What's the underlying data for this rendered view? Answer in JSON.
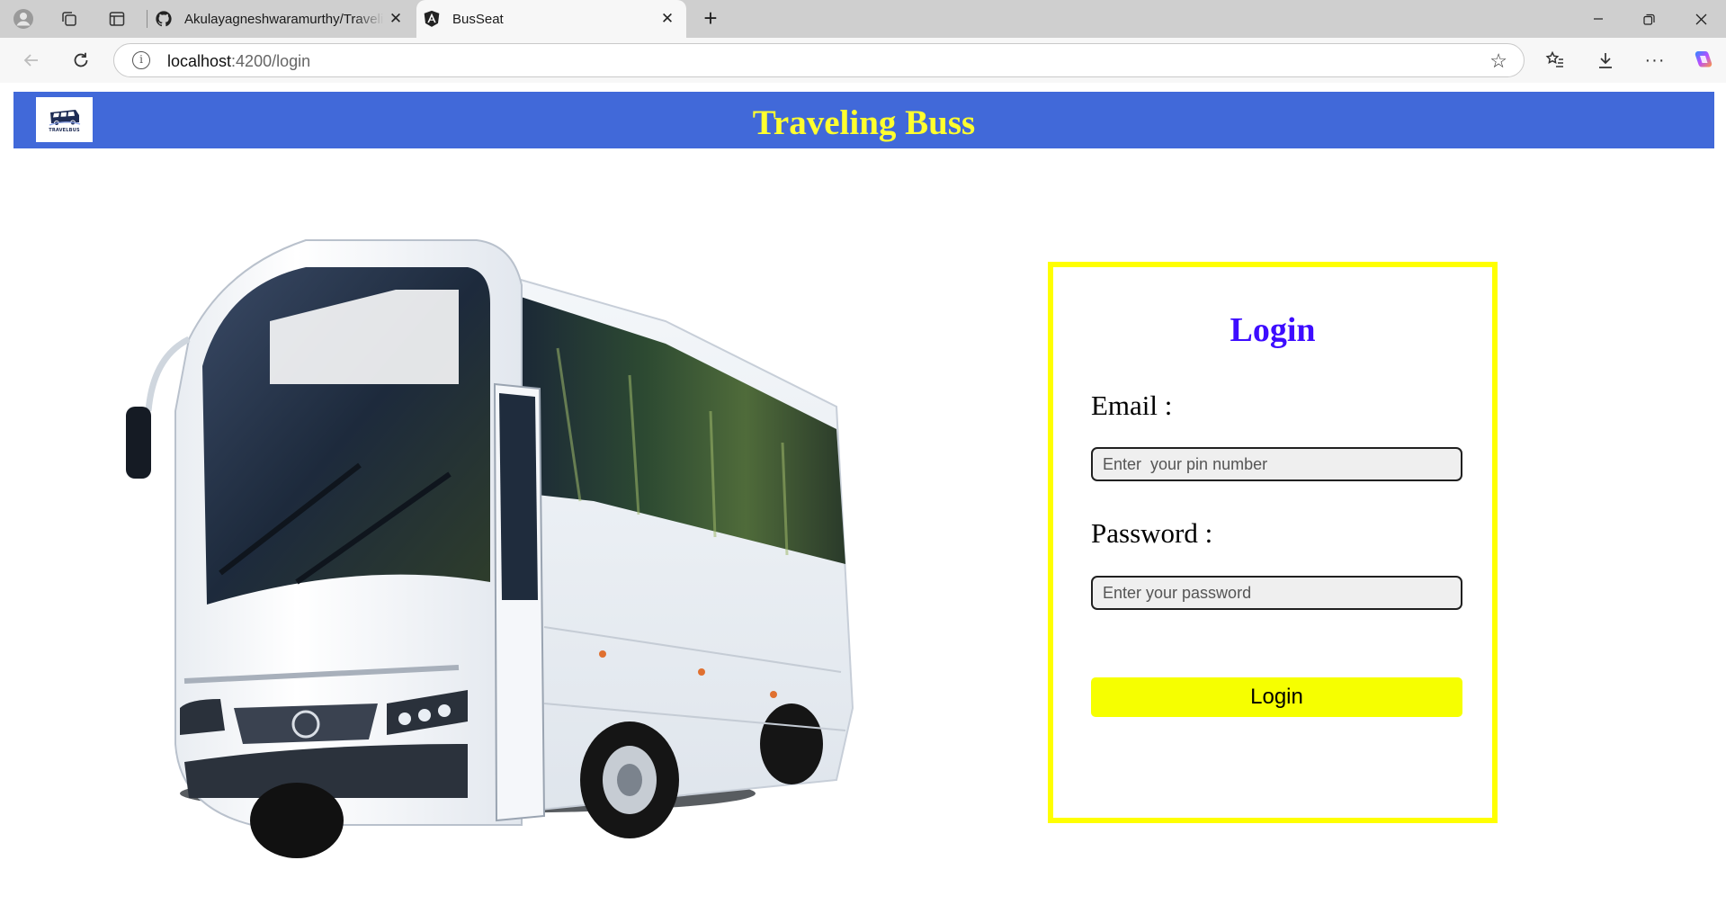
{
  "browser": {
    "tabs": [
      {
        "title": "Akulayagneshwaramurthy/Traveli",
        "favicon": "github-icon",
        "active": false
      },
      {
        "title": "BusSeat",
        "favicon": "angular-icon",
        "active": true
      }
    ],
    "url_host": "localhost",
    "url_path": ":4200/login",
    "info_glyph": "i"
  },
  "header": {
    "title": "Traveling Buss",
    "logo_text": "TRAVELBUS"
  },
  "login": {
    "title": "Login",
    "email_label": "Email :",
    "email_placeholder": "Enter  your pin number",
    "password_label": "Password :",
    "password_placeholder": "Enter your password",
    "button_label": "Login"
  },
  "colors": {
    "header_bg": "#4169d9",
    "title_color": "#ffff2e",
    "login_border": "#ffff00",
    "login_title": "#3d0cff",
    "button_bg": "#f6ff00"
  }
}
